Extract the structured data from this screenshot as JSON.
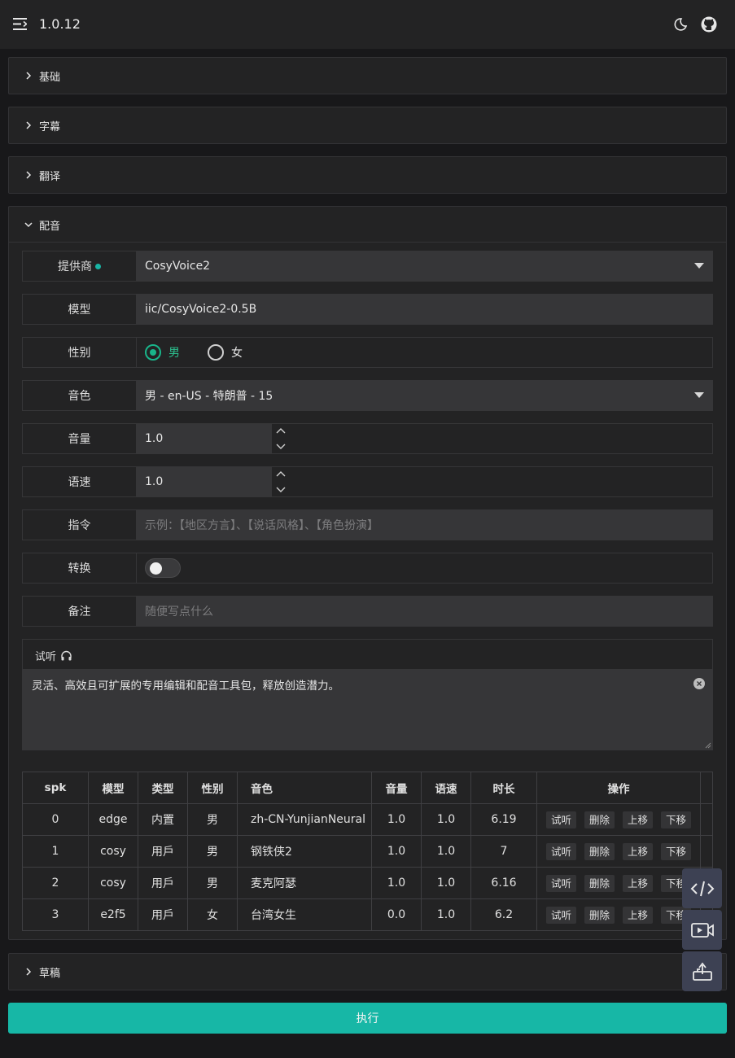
{
  "header": {
    "version": "1.0.12"
  },
  "sections": {
    "basic": "基础",
    "subtitle": "字幕",
    "translate": "翻译",
    "dubbing": "配音",
    "draft": "草稿"
  },
  "dubbing": {
    "provider": {
      "label": "提供商",
      "value": "CosyVoice2"
    },
    "model": {
      "label": "模型",
      "value": "iic/CosyVoice2-0.5B"
    },
    "gender": {
      "label": "性别",
      "male": "男",
      "female": "女",
      "selected": "male"
    },
    "voice": {
      "label": "音色",
      "value": "男 - en-US - 特朗普 - 15"
    },
    "volume": {
      "label": "音量",
      "value": "1.0"
    },
    "speed": {
      "label": "语速",
      "value": "1.0"
    },
    "instruction": {
      "label": "指令",
      "placeholder": "示例：【地区方言】、【说话风格】、【角色扮演】"
    },
    "convert": {
      "label": "转换",
      "on": false
    },
    "note": {
      "label": "备注",
      "placeholder": "随便写点什么"
    },
    "listen": {
      "label": "试听",
      "text": "灵活、高效且可扩展的专用编辑和配音工具包，释放创造潜力。"
    }
  },
  "table": {
    "headers": [
      "spk",
      "模型",
      "类型",
      "性别",
      "音色",
      "音量",
      "语速",
      "时长",
      "操作"
    ],
    "ops": [
      "试听",
      "删除",
      "上移",
      "下移"
    ],
    "rows": [
      {
        "spk": "0",
        "model": "edge",
        "type": "内置",
        "gender": "男",
        "voice": "zh-CN-YunjianNeural",
        "volume": "1.0",
        "speed": "1.0",
        "duration": "6.19"
      },
      {
        "spk": "1",
        "model": "cosy",
        "type": "用戶",
        "gender": "男",
        "voice": "钢铁侠2",
        "volume": "1.0",
        "speed": "1.0",
        "duration": "7"
      },
      {
        "spk": "2",
        "model": "cosy",
        "type": "用戶",
        "gender": "男",
        "voice": "麦克阿瑟",
        "volume": "1.0",
        "speed": "1.0",
        "duration": "6.16"
      },
      {
        "spk": "3",
        "model": "e2f5",
        "type": "用戶",
        "gender": "女",
        "voice": "台湾女生",
        "volume": "0.0",
        "speed": "1.0",
        "duration": "6.2"
      }
    ]
  },
  "execute": {
    "label": "执行"
  },
  "colors": {
    "accent": "#17b7a6",
    "radio_on": "#19b58a",
    "float_btn": "#3d4153"
  },
  "icons": [
    "menu-icon",
    "moon-icon",
    "github-icon",
    "chevron-right-icon",
    "chevron-down-icon",
    "headphone-icon",
    "code-icon",
    "video-icon",
    "export-icon"
  ]
}
